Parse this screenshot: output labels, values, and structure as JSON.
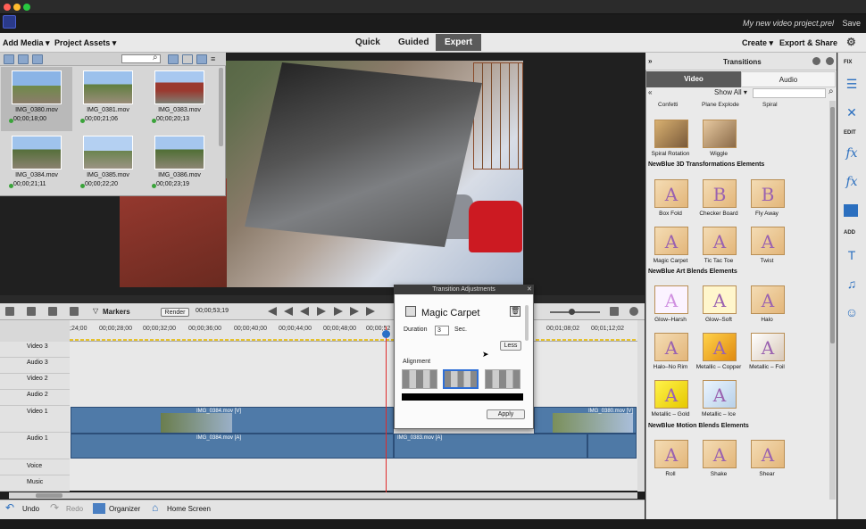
{
  "app": {
    "project_name": "My new video project.prel",
    "save_label": "Save"
  },
  "menubar": {
    "add_media": "Add Media ▾",
    "project_assets": "Project Assets ▾",
    "modes": [
      "Quick",
      "Guided",
      "Expert"
    ],
    "create": "Create ▾",
    "export_share": "Export & Share"
  },
  "assets": [
    {
      "name": "IMG_0380.mov",
      "duration": "00;00;18;00"
    },
    {
      "name": "IMG_0381.mov",
      "duration": "00;00;21;06"
    },
    {
      "name": "IMG_0383.mov",
      "duration": "00;00;20;13"
    },
    {
      "name": "IMG_0384.mov",
      "duration": "00;00;21;11"
    },
    {
      "name": "IMG_0385.mov",
      "duration": "00;00;22;20"
    },
    {
      "name": "IMG_0386.mov",
      "duration": "00;00;23;19"
    }
  ],
  "timeline": {
    "markers_label": "Markers",
    "render_label": "Render",
    "timecode": "00;00;53;19",
    "ruler": [
      ";24;00",
      "00;00;28;00",
      "00;00;32;00",
      "00;00;36;00",
      "00;00;40;00",
      "00;00;44;00",
      "00;00;48;00",
      "00;00;52",
      "00;01;08;02",
      "00;01;12;02"
    ],
    "tracks": [
      "Video 3",
      "Audio 3",
      "Video 2",
      "Audio 2",
      "Video 1",
      "Audio 1",
      "Voice",
      "Music"
    ],
    "clips": {
      "v1a": "IMG_0384.mov [V]",
      "v1b": "IMG_0380.mov [V]",
      "a1a": "IMG_0384.mov [A]",
      "a1b": "IMG_0383.mov [A]"
    }
  },
  "statusbar": {
    "undo": "Undo",
    "redo": "Redo",
    "organizer": "Organizer",
    "home": "Home Screen"
  },
  "dialog": {
    "title": "Transition Adjustments",
    "name": "Magic Carpet",
    "duration_label": "Duration",
    "duration_value": "3",
    "sec_label": "Sec.",
    "less_label": "Less",
    "alignment_label": "Alignment",
    "apply_label": "Apply"
  },
  "panel": {
    "title": "Transitions",
    "tab_video": "Video",
    "tab_audio": "Audio",
    "show_all": "Show All ▾",
    "top_names": [
      "Confetti",
      "Plane Explode",
      "Spiral"
    ],
    "row2": [
      "Spiral Rotation",
      "Wiggle"
    ],
    "section1": "NewBlue 3D Transformations Elements",
    "s1": [
      "Box Fold",
      "Checker Board",
      "Fly Away",
      "Magic Carpet",
      "Tic Tac Toe",
      "Twist"
    ],
    "section2": "NewBlue Art Blends Elements",
    "s2": [
      "Glow–Harsh",
      "Glow–Soft",
      "Halo",
      "Halo–No Rim",
      "Metallic – Copper",
      "Metallic – Foil",
      "Metallic – Gold",
      "Metallic – Ice"
    ],
    "section3": "NewBlue Motion Blends Elements",
    "s3": [
      "Roll",
      "Shake",
      "Shear"
    ]
  },
  "rightbar": {
    "fix": "FIX",
    "edit": "EDIT",
    "add": "ADD"
  }
}
